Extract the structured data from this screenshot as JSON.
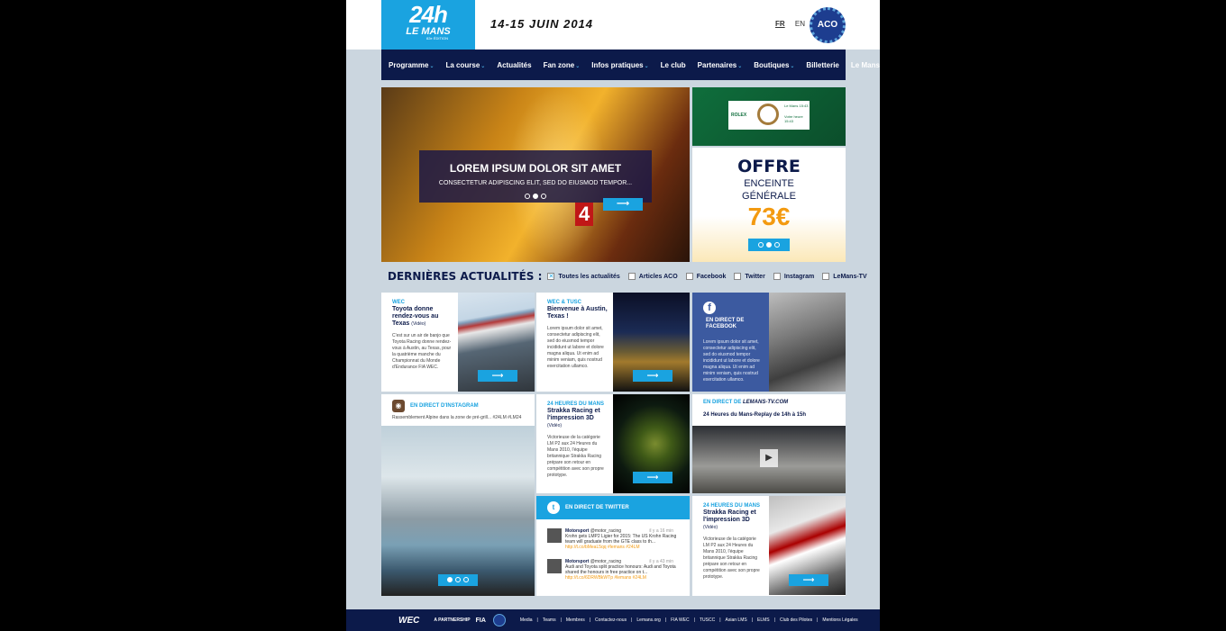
{
  "header": {
    "logo_big": "24h",
    "logo_small": "LE MANS",
    "logo_edition": "82e ÉDITION",
    "dates": "14-15 JUIN 2014",
    "lang_fr": "FR",
    "lang_en": "EN",
    "aco_label": "ACO"
  },
  "nav": {
    "items": [
      "Programme",
      "La course",
      "Actualités",
      "Fan zone",
      "Infos pratiques",
      "Le club",
      "Partenaires",
      "Boutiques",
      "Billetterie",
      "Le Mans TV"
    ],
    "dropdown_flags": [
      true,
      true,
      false,
      true,
      true,
      false,
      true,
      true,
      false,
      false
    ]
  },
  "hero": {
    "title": "LOREM IPSUM DOLOR SIT AMET",
    "subtitle": "CONSECTETUR ADIPISCING ELIT, SED DO EIUSMOD TEMPOR...",
    "car_number": "4"
  },
  "rolex": {
    "brand": "ROLEX",
    "line1": "Le Mans",
    "time1": "15:43",
    "line2": "Votre heure",
    "time2": "15:43"
  },
  "offer": {
    "title": "OFFRE",
    "line1": "ENCEINTE",
    "line2": "GÉNÉRALE",
    "price": "73€"
  },
  "news": {
    "title": "DERNIÈRES ACTUALITÉS :",
    "filters": [
      {
        "label": "Toutes les actualités",
        "checked": true
      },
      {
        "label": "Articles ACO",
        "checked": false
      },
      {
        "label": "Facebook",
        "checked": false
      },
      {
        "label": "Twitter",
        "checked": false
      },
      {
        "label": "Instagram",
        "checked": false
      },
      {
        "label": "LeMans-TV",
        "checked": false
      }
    ]
  },
  "tiles": {
    "wec": {
      "cat": "WEC",
      "head": "Toyota donne rendez-vous au Texas",
      "vid": "(Vidéo)",
      "body": "C'est sur un air de banjo que Toyota Racing donne rendez-vous à Austin, au Texas, pour la quatrième manche du Championnat du Monde d'Endurance FIA WEC."
    },
    "tusc": {
      "cat": "WEC & TUSC",
      "head": "Bienvenue à Austin, Texas !",
      "body": "Lorem ipsum dolor sit amet, consectetur adipiscing elit, sed do eiusmod tempor incididunt ut labore et dolore magna aliqua. Ut enim ad minim veniam, quis nostrud exercitation ullamco."
    },
    "facebook": {
      "title": "EN DIRECT DE FACEBOOK",
      "body": "Lorem ipsum dolor sit amet, consectetur adipiscing elit, sed do eiusmod tempor incididunt ut labore et dolore magna aliqua. Ut enim ad minim veniam, quis nostrud exercitation ullamco."
    },
    "instagram": {
      "title": "EN DIRECT D'INSTAGRAM",
      "caption": "Rassemblement Alpine dans la zone de pré-grill... #24LM #LM24"
    },
    "strakka1": {
      "cat": "24 HEURES DU MANS",
      "head": "Strakka Racing et l'impression 3D",
      "vid": "(Vidéo)",
      "body": "Victorieuse de la catégorie LM P2 aux 24 Heures du Mans 2010, l'équipe britannique Strakka Racing prépare son retour en compétition avec son propre prototype."
    },
    "lemanstv": {
      "prefix": "EN DIRECT DE",
      "brand": "LEMANS-TV.COM",
      "caption": "24 Heures du Mans-Replay de 14h à 15h"
    },
    "twitter": {
      "title": "EN DIRECT DE TWITTER",
      "tweets": [
        {
          "author": "Motorsport",
          "handle": "@motor_racing",
          "time": "il y a 16 min",
          "text": "Krohn gets LMP2 Ligier for 2015: The US Krohn Racing team will graduate from the GTE class to th...",
          "link": "http://t.co/bMeaL5qq #lemans #24LM"
        },
        {
          "author": "Motorsport",
          "handle": "@motor_racing",
          "time": "il y a 43 min",
          "text": "Audi and Toyota split practice honours: Audi and Toyota shared the honours in free practice on t...",
          "link": "http://t.co/6DRWBkWTp #lemans #24LM"
        }
      ]
    },
    "strakka2": {
      "cat": "24 HEURES DU MANS",
      "head": "Strakka Racing et l'impression 3D",
      "vid": "(Vidéo)",
      "body": "Victorieuse de la catégorie LM P2 aux 24 Heures du Mans 2010, l'équipe britannique Strakka Racing prépare son retour en compétition avec son propre prototype."
    }
  },
  "footer": {
    "wec": "WEC",
    "partnership": "A PARTNERSHIP",
    "fia": "FIA",
    "links": [
      "Media",
      "Teams",
      "Membres",
      "Contactez-nous",
      "Lemans.org",
      "FIA WEC",
      "TUSCC",
      "Asian LMS",
      "ELMS",
      "Club des Pilotes",
      "Mentions Légales"
    ]
  },
  "colors": {
    "brand_blue": "#1aa3e0",
    "navy": "#0c1a4a",
    "orange": "#f39a10",
    "facebook": "#3c5aa0",
    "rolex_green": "#0f6e3c"
  }
}
